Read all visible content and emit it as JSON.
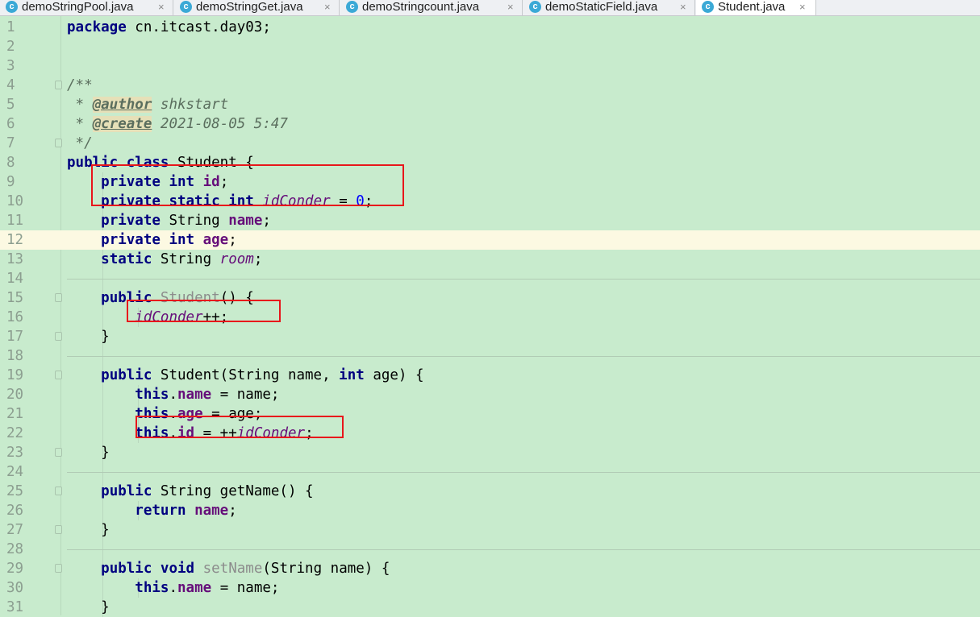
{
  "tabs": [
    {
      "label": "demoStringPool.java",
      "icon": "c-class-icon",
      "active": false
    },
    {
      "label": "demoStringGet.java",
      "icon": "c-class-icon",
      "active": false
    },
    {
      "label": "demoStringcount.java",
      "icon": "c-class-icon",
      "active": false
    },
    {
      "label": "demoStaticField.java",
      "icon": "c-class-icon",
      "active": false
    },
    {
      "label": "Student.java",
      "icon": "c-class-icon",
      "active": true
    }
  ],
  "tab_close_glyph": "×",
  "class_icon_letter": "c",
  "colors": {
    "background": "#c8ebcd",
    "current_line": "#fcf9e2",
    "keyword": "#000080",
    "field": "#660e7a",
    "number": "#0000ff",
    "highlight_box": "#e8161b"
  },
  "editor": {
    "current_line": 12,
    "lines": [
      {
        "n": "1",
        "html": "<span class='kw'>package</span> cn.itcast.day03;"
      },
      {
        "n": "2",
        "html": ""
      },
      {
        "n": "3",
        "html": ""
      },
      {
        "n": "4",
        "html": "<span class='doc'>/**</span>"
      },
      {
        "n": "5",
        "html": "<span class='doc'> * </span><span class='doctag'>@author</span><span class='doc'> shkstart</span>"
      },
      {
        "n": "6",
        "html": "<span class='doc'> * </span><span class='doctag'>@create</span><span class='doc'> 2021-08-05 5:47</span>"
      },
      {
        "n": "7",
        "html": "<span class='doc'> */</span>"
      },
      {
        "n": "8",
        "html": "<span class='kw'>public class</span> Student {"
      },
      {
        "n": "9",
        "html": "    <span class='kw'>private int</span> <span class='fld'>id</span>;"
      },
      {
        "n": "10",
        "html": "    <span class='kw'>private static int</span> <span class='sfld'>idConder</span> = <span class='num'>0</span>;"
      },
      {
        "n": "11",
        "html": "    <span class='kw'>private</span> String <span class='fld'>name</span>;"
      },
      {
        "n": "12",
        "html": "    <span class='kw'>private int</span> <span class='fld'>age</span>;"
      },
      {
        "n": "13",
        "html": "    <span class='kw'>static</span> String <span class='sfld'>room</span>;"
      },
      {
        "n": "14",
        "html": ""
      },
      {
        "n": "15",
        "html": "    <span class='kw'>public</span> <span class='unused'>Student</span>() {"
      },
      {
        "n": "16",
        "html": "        <span class='sfld'>idConder</span>++;"
      },
      {
        "n": "17",
        "html": "    }"
      },
      {
        "n": "18",
        "html": ""
      },
      {
        "n": "19",
        "html": "    <span class='kw'>public</span> Student(String name, <span class='kw'>int</span> age) {"
      },
      {
        "n": "20",
        "html": "        <span class='kw'>this</span>.<span class='fld'>name</span> = name;"
      },
      {
        "n": "21",
        "html": "        <span class='kw'>this</span>.<span class='fld'>age</span> = age;"
      },
      {
        "n": "22",
        "html": "        <span class='kw'>this</span>.<span class='fld'>id</span> = ++<span class='sfld'>idConder</span>;"
      },
      {
        "n": "23",
        "html": "    }"
      },
      {
        "n": "24",
        "html": ""
      },
      {
        "n": "25",
        "html": "    <span class='kw'>public</span> String getName() {"
      },
      {
        "n": "26",
        "html": "        <span class='kw'>return</span> <span class='fld'>name</span>;"
      },
      {
        "n": "27",
        "html": "    }"
      },
      {
        "n": "28",
        "html": ""
      },
      {
        "n": "29",
        "html": "    <span class='kw'>public void</span> <span class='unused'>setName</span>(String name) {"
      },
      {
        "n": "30",
        "html": "        <span class='kw'>this</span>.<span class='fld'>name</span> = name;"
      },
      {
        "n": "31",
        "html": "    }"
      }
    ],
    "fold_lines": [
      4,
      7,
      15,
      17,
      19,
      23,
      25,
      27,
      29
    ],
    "separator_after_lines": [
      14,
      18,
      24,
      28
    ],
    "highlight_ranges": [
      {
        "from_line": 9,
        "to_line": 10
      },
      {
        "from_line": 16,
        "to_line": 16
      },
      {
        "from_line": 22,
        "to_line": 22
      }
    ]
  }
}
